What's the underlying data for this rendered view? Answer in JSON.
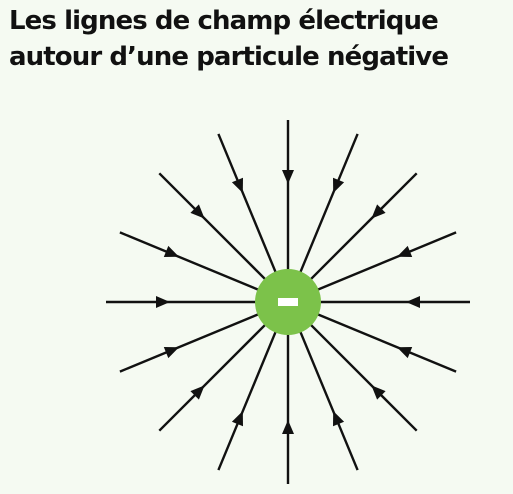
{
  "title": {
    "line1": "Les lignes de champ électrique",
    "line2": "autour d’une particule négative"
  },
  "particle": {
    "sign": "-",
    "charge": "negative",
    "color": "#7cc24a",
    "sign_color": "#ffffff"
  },
  "field_lines": {
    "count": 16,
    "direction": "inward",
    "color": "#111111",
    "arrowheads_per_line": 1
  },
  "colors": {
    "background": "#f5faf2",
    "title": "#111111"
  }
}
